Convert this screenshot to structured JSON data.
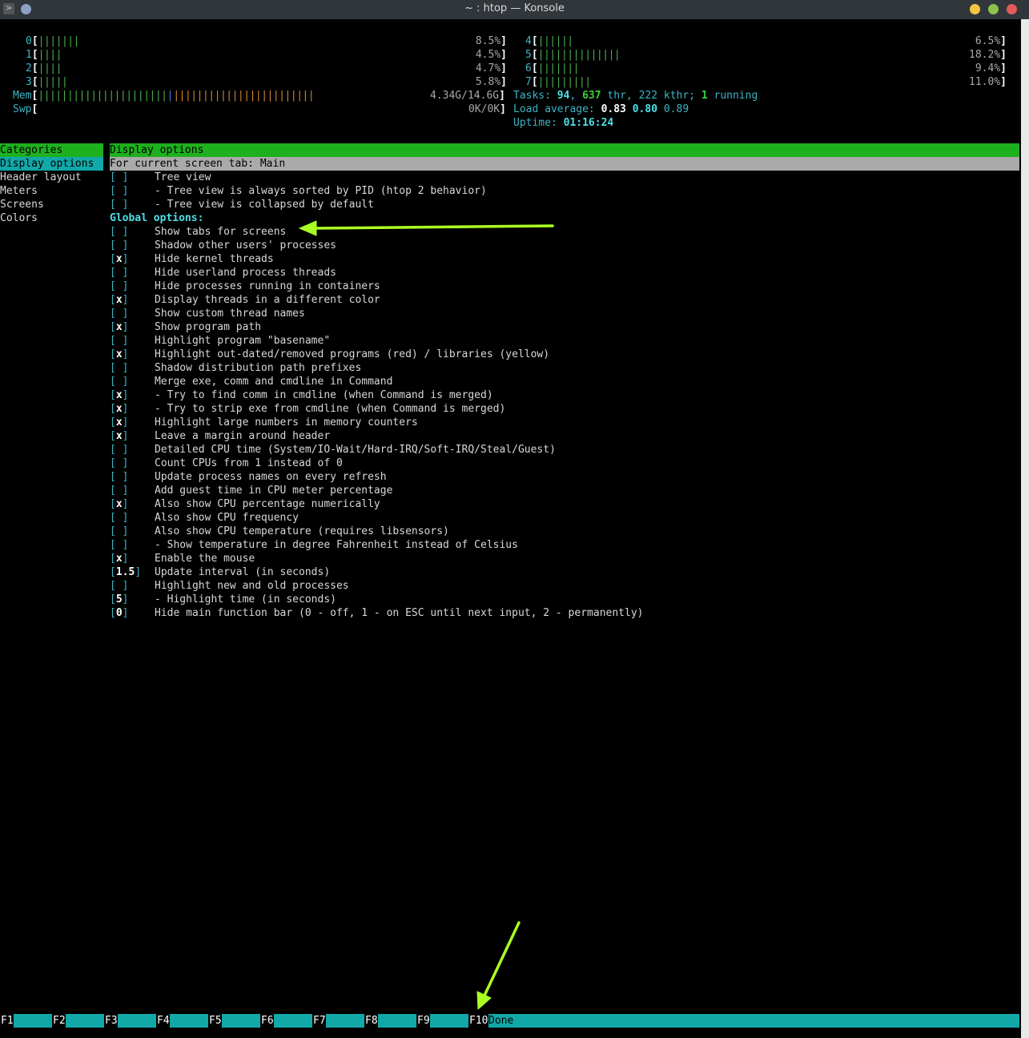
{
  "window": {
    "title": "~ : htop — Konsole"
  },
  "cpus": [
    {
      "id": "0",
      "bar": "|||||||",
      "pct": "8.5%"
    },
    {
      "id": "1",
      "bar": "||||",
      "pct": "4.5%"
    },
    {
      "id": "2",
      "bar": "||||",
      "pct": "4.7%"
    },
    {
      "id": "3",
      "bar": "|||||",
      "pct": "5.8%"
    },
    {
      "id": "4",
      "bar": "||||||",
      "pct": "6.5%"
    },
    {
      "id": "5",
      "bar": "||||||||||||||",
      "pct": "18.2%"
    },
    {
      "id": "6",
      "bar": "|||||||",
      "pct": "9.4%"
    },
    {
      "id": "7",
      "bar": "|||||||||",
      "pct": "11.0%"
    }
  ],
  "mem": {
    "label": "Mem",
    "bar_green": "||||||||||||||||||||||",
    "bar_blue": "|",
    "bar_red": "||||||||||||||||||||||||",
    "value": "4.34G/14.6G"
  },
  "swp": {
    "label": "Swp",
    "value": "0K/0K"
  },
  "tasks": {
    "label": "Tasks:",
    "count": "94",
    "sep1": ",",
    "thr": "637",
    "thr_label": "thr,",
    "kthr": "222",
    "kthr_label": "kthr;",
    "running": "1",
    "running_label": "running"
  },
  "load": {
    "label": "Load average:",
    "l1": "0.83",
    "l5": "0.80",
    "l15": "0.89"
  },
  "uptime": {
    "label": "Uptime:",
    "value": "01:16:24"
  },
  "categories": {
    "header": "Categories",
    "items": [
      "Display options",
      "Header layout",
      "Meters",
      "Screens",
      "Colors"
    ],
    "selected": "Display options"
  },
  "panel": {
    "header": "Display options",
    "subheader": "For current screen tab: Main",
    "global_label": "Global options:"
  },
  "tab_options": [
    {
      "mark": " ",
      "text": "Tree view"
    },
    {
      "mark": " ",
      "text": "- Tree view is always sorted by PID (htop 2 behavior)"
    },
    {
      "mark": " ",
      "text": "- Tree view is collapsed by default"
    }
  ],
  "global_options": [
    {
      "mark": " ",
      "text": "Show tabs for screens"
    },
    {
      "mark": " ",
      "text": "Shadow other users' processes"
    },
    {
      "mark": "x",
      "text": "Hide kernel threads"
    },
    {
      "mark": " ",
      "text": "Hide userland process threads"
    },
    {
      "mark": " ",
      "text": "Hide processes running in containers"
    },
    {
      "mark": "x",
      "text": "Display threads in a different color"
    },
    {
      "mark": " ",
      "text": "Show custom thread names"
    },
    {
      "mark": "x",
      "text": "Show program path"
    },
    {
      "mark": " ",
      "text": "Highlight program \"basename\""
    },
    {
      "mark": "x",
      "text": "Highlight out-dated/removed programs (red) / libraries (yellow)"
    },
    {
      "mark": " ",
      "text": "Shadow distribution path prefixes"
    },
    {
      "mark": " ",
      "text": "Merge exe, comm and cmdline in Command"
    },
    {
      "mark": "x",
      "text": "- Try to find comm in cmdline (when Command is merged)"
    },
    {
      "mark": "x",
      "text": "- Try to strip exe from cmdline (when Command is merged)"
    },
    {
      "mark": "x",
      "text": "Highlight large numbers in memory counters"
    },
    {
      "mark": "x",
      "text": "Leave a margin around header"
    },
    {
      "mark": " ",
      "text": "Detailed CPU time (System/IO-Wait/Hard-IRQ/Soft-IRQ/Steal/Guest)"
    },
    {
      "mark": " ",
      "text": "Count CPUs from 1 instead of 0"
    },
    {
      "mark": " ",
      "text": "Update process names on every refresh"
    },
    {
      "mark": " ",
      "text": "Add guest time in CPU meter percentage"
    },
    {
      "mark": "x",
      "text": "Also show CPU percentage numerically"
    },
    {
      "mark": " ",
      "text": "Also show CPU frequency"
    },
    {
      "mark": " ",
      "text": "Also show CPU temperature (requires libsensors)"
    },
    {
      "mark": " ",
      "text": "- Show temperature in degree Fahrenheit instead of Celsius"
    },
    {
      "mark": "x",
      "text": "Enable the mouse"
    },
    {
      "mark": "1.5",
      "text": "Update interval (in seconds)"
    },
    {
      "mark": " ",
      "text": "Highlight new and old processes"
    },
    {
      "mark": "5",
      "text": "- Highlight time (in seconds)"
    },
    {
      "mark": "0",
      "text": "Hide main function bar (0 - off, 1 - on ESC until next input, 2 - permanently)"
    }
  ],
  "function_bar": {
    "keys": [
      "F1",
      "F2",
      "F3",
      "F4",
      "F5",
      "F6",
      "F7",
      "F8",
      "F9",
      "F10"
    ],
    "f10_label": "Done"
  },
  "annotation_color": "#aaff22"
}
